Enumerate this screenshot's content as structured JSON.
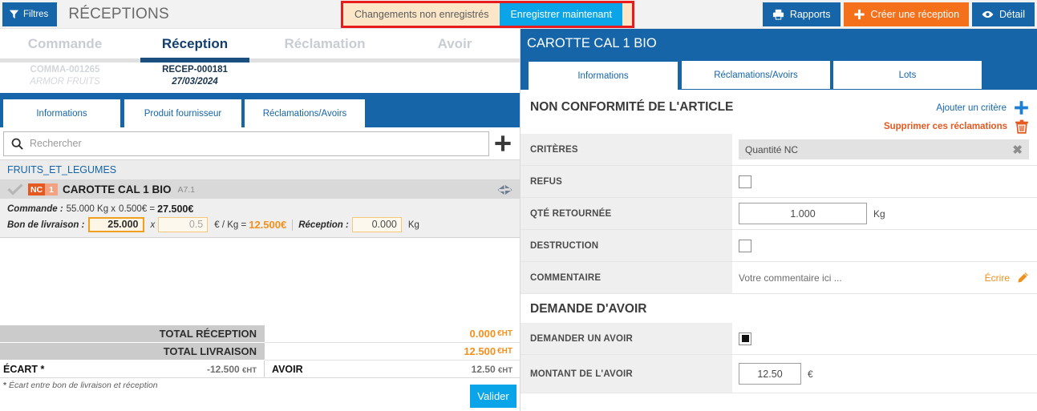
{
  "topbar": {
    "filters_label": "Filtres",
    "page_title": "RÉCEPTIONS",
    "unsaved_label": "Changements non enregistrés",
    "save_now_label": "Enregistrer maintenant",
    "reports_label": "Rapports",
    "create_label": "Créer une réception",
    "detail_label": "Détail",
    "accent_blue": "#1565a8",
    "accent_orange": "#f4701b",
    "alert_red": "#e81c1c",
    "unsaved_bg": "#fbe7c8"
  },
  "main_tabs": [
    {
      "label": "Commande",
      "line1": "COMMA-001265",
      "line2": "ARMOR FRUITS",
      "active": false
    },
    {
      "label": "Réception",
      "line1": "RECEP-000181",
      "line2": "27/03/2024",
      "active": true
    },
    {
      "label": "Réclamation",
      "line1": "",
      "line2": "",
      "active": false
    },
    {
      "label": "Avoir",
      "line1": "",
      "line2": "",
      "active": false
    }
  ],
  "left_subtabs": [
    {
      "label": "Informations",
      "active": true
    },
    {
      "label": "Produit fournisseur",
      "active": false
    },
    {
      "label": "Réclamations/Avoirs",
      "active": false
    }
  ],
  "search": {
    "placeholder": "Rechercher",
    "value": "",
    "add_icon": "plus-icon"
  },
  "list": {
    "category": "FRUITS_ET_LEGUMES",
    "product": {
      "nc_tag": "NC",
      "nc_count": "1",
      "name": "CAROTTE CAL 1 BIO",
      "code": "A7.1",
      "commande_label": "Commande :",
      "commande_qty": "55.000 Kg x",
      "commande_price": "0.500€ =",
      "commande_total": "27.500€",
      "bl_label": "Bon de livraison :",
      "bl_qty": "25.000",
      "bl_x": "x",
      "bl_price": "0.5",
      "bl_unit": "€ / Kg =",
      "bl_total": "12.500€",
      "reception_label": "Réception :",
      "reception_qty": "0.000",
      "reception_unit": "Kg"
    }
  },
  "totals": {
    "reception_label": "TOTAL RÉCEPTION",
    "reception_value": "0.000",
    "livraison_label": "TOTAL LIVRAISON",
    "livraison_value": "12.500",
    "currency_suffix": "€HT",
    "ecart_label": "ÉCART *",
    "ecart_value": "-12.500",
    "avoir_label": "AVOIR",
    "avoir_value": "12.50",
    "footnote_star": "*",
    "footnote": " Écart entre bon de livraison et réception",
    "validate_label": "Valider"
  },
  "right_panel": {
    "title": "CAROTTE CAL 1 BIO",
    "tabs": [
      {
        "label": "Informations",
        "active": false
      },
      {
        "label": "Réclamations/Avoirs",
        "active": true
      },
      {
        "label": "Lots",
        "active": false
      }
    ],
    "section_title": "NON CONFORMITÉ DE L'ARTICLE",
    "add_criteria_label": "Ajouter un critère",
    "delete_claims_label": "Supprimer ces réclamations",
    "fields": {
      "criteres_label": "CRITÈRES",
      "criteres_value": "Quantité NC",
      "refus_label": "REFUS",
      "refus_checked": false,
      "qte_retournee_label": "QTÉ RETOURNÉE",
      "qte_retournee_value": "1.000",
      "qte_retournee_unit": "Kg",
      "destruction_label": "DESTRUCTION",
      "destruction_checked": false,
      "commentaire_label": "COMMENTAIRE",
      "commentaire_placeholder": "Votre commentaire ici ...",
      "commentaire_action": "Écrire"
    },
    "section2_title": "DEMANDE D'AVOIR",
    "avoir_fields": {
      "demander_label": "DEMANDER UN AVOIR",
      "demander_checked": true,
      "montant_label": "MONTANT DE L'AVOIR",
      "montant_value": "12.50",
      "montant_unit": "€"
    }
  }
}
